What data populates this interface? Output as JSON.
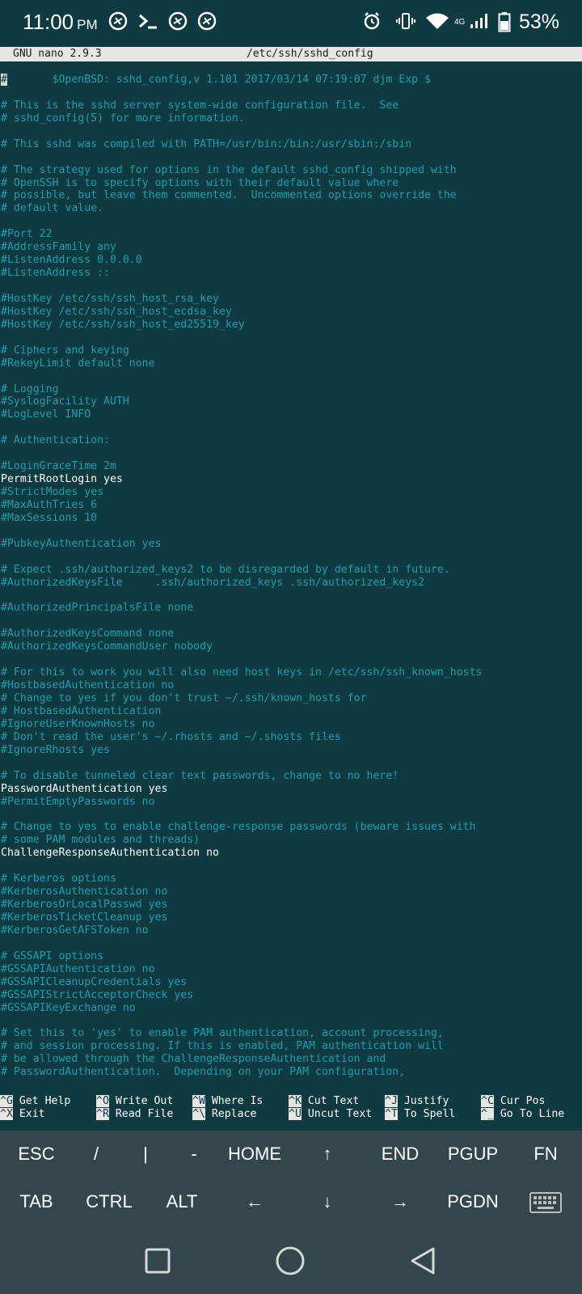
{
  "status_bar": {
    "time": "11:00",
    "ampm": "PM",
    "network": "4G",
    "battery": "53%",
    "icons": [
      "pizza-icon",
      "terminal-prompt-icon",
      "pizza-icon",
      "pizza-icon",
      "alarm-icon",
      "vibrate-icon",
      "wifi-icon",
      "signal-icon",
      "battery-icon"
    ]
  },
  "titlebar": {
    "app": "GNU nano 2.9.3",
    "file": "/etc/ssh/sshd_config"
  },
  "editor": {
    "cursor_char": "#",
    "lines": [
      {
        "text": "#\t$OpenBSD: sshd_config,v 1.101 2017/03/14 07:19:07 djm Exp $",
        "active": false
      },
      {
        "text": "",
        "active": false
      },
      {
        "text": "# This is the sshd server system-wide configuration file.  See",
        "active": false
      },
      {
        "text": "# sshd_config(5) for more information.",
        "active": false
      },
      {
        "text": "",
        "active": false
      },
      {
        "text": "# This sshd was compiled with PATH=/usr/bin:/bin:/usr/sbin:/sbin",
        "active": false
      },
      {
        "text": "",
        "active": false
      },
      {
        "text": "# The strategy used for options in the default sshd_config shipped with",
        "active": false
      },
      {
        "text": "# OpenSSH is to specify options with their default value where",
        "active": false
      },
      {
        "text": "# possible, but leave them commented.  Uncommented options override the",
        "active": false
      },
      {
        "text": "# default value.",
        "active": false
      },
      {
        "text": "",
        "active": false
      },
      {
        "text": "#Port 22",
        "active": false
      },
      {
        "text": "#AddressFamily any",
        "active": false
      },
      {
        "text": "#ListenAddress 0.0.0.0",
        "active": false
      },
      {
        "text": "#ListenAddress ::",
        "active": false
      },
      {
        "text": "",
        "active": false
      },
      {
        "text": "#HostKey /etc/ssh/ssh_host_rsa_key",
        "active": false
      },
      {
        "text": "#HostKey /etc/ssh/ssh_host_ecdsa_key",
        "active": false
      },
      {
        "text": "#HostKey /etc/ssh/ssh_host_ed25519_key",
        "active": false
      },
      {
        "text": "",
        "active": false
      },
      {
        "text": "# Ciphers and keying",
        "active": false
      },
      {
        "text": "#RekeyLimit default none",
        "active": false
      },
      {
        "text": "",
        "active": false
      },
      {
        "text": "# Logging",
        "active": false
      },
      {
        "text": "#SyslogFacility AUTH",
        "active": false
      },
      {
        "text": "#LogLevel INFO",
        "active": false
      },
      {
        "text": "",
        "active": false
      },
      {
        "text": "# Authentication:",
        "active": false
      },
      {
        "text": "",
        "active": false
      },
      {
        "text": "#LoginGraceTime 2m",
        "active": false
      },
      {
        "text": "PermitRootLogin yes",
        "active": true
      },
      {
        "text": "#StrictModes yes",
        "active": false
      },
      {
        "text": "#MaxAuthTries 6",
        "active": false
      },
      {
        "text": "#MaxSessions 10",
        "active": false
      },
      {
        "text": "",
        "active": false
      },
      {
        "text": "#PubkeyAuthentication yes",
        "active": false
      },
      {
        "text": "",
        "active": false
      },
      {
        "text": "# Expect .ssh/authorized_keys2 to be disregarded by default in future.",
        "active": false
      },
      {
        "text": "#AuthorizedKeysFile\t.ssh/authorized_keys .ssh/authorized_keys2",
        "active": false
      },
      {
        "text": "",
        "active": false
      },
      {
        "text": "#AuthorizedPrincipalsFile none",
        "active": false
      },
      {
        "text": "",
        "active": false
      },
      {
        "text": "#AuthorizedKeysCommand none",
        "active": false
      },
      {
        "text": "#AuthorizedKeysCommandUser nobody",
        "active": false
      },
      {
        "text": "",
        "active": false
      },
      {
        "text": "# For this to work you will also need host keys in /etc/ssh/ssh_known_hosts",
        "active": false
      },
      {
        "text": "#HostbasedAuthentication no",
        "active": false
      },
      {
        "text": "# Change to yes if you don't trust ~/.ssh/known_hosts for",
        "active": false
      },
      {
        "text": "# HostbasedAuthentication",
        "active": false
      },
      {
        "text": "#IgnoreUserKnownHosts no",
        "active": false
      },
      {
        "text": "# Don't read the user's ~/.rhosts and ~/.shosts files",
        "active": false
      },
      {
        "text": "#IgnoreRhosts yes",
        "active": false
      },
      {
        "text": "",
        "active": false
      },
      {
        "text": "# To disable tunneled clear text passwords, change to no here!",
        "active": false
      },
      {
        "text": "PasswordAuthentication yes",
        "active": true
      },
      {
        "text": "#PermitEmptyPasswords no",
        "active": false
      },
      {
        "text": "",
        "active": false
      },
      {
        "text": "# Change to yes to enable challenge-response passwords (beware issues with",
        "active": false
      },
      {
        "text": "# some PAM modules and threads)",
        "active": false
      },
      {
        "text": "ChallengeResponseAuthentication no",
        "active": true
      },
      {
        "text": "",
        "active": false
      },
      {
        "text": "# Kerberos options",
        "active": false
      },
      {
        "text": "#KerberosAuthentication no",
        "active": false
      },
      {
        "text": "#KerberosOrLocalPasswd yes",
        "active": false
      },
      {
        "text": "#KerberosTicketCleanup yes",
        "active": false
      },
      {
        "text": "#KerberosGetAFSToken no",
        "active": false
      },
      {
        "text": "",
        "active": false
      },
      {
        "text": "# GSSAPI options",
        "active": false
      },
      {
        "text": "#GSSAPIAuthentication no",
        "active": false
      },
      {
        "text": "#GSSAPICleanupCredentials yes",
        "active": false
      },
      {
        "text": "#GSSAPIStrictAcceptorCheck yes",
        "active": false
      },
      {
        "text": "#GSSAPIKeyExchange no",
        "active": false
      },
      {
        "text": "",
        "active": false
      },
      {
        "text": "# Set this to 'yes' to enable PAM authentication, account processing,",
        "active": false
      },
      {
        "text": "# and session processing. If this is enabled, PAM authentication will",
        "active": false
      },
      {
        "text": "# be allowed through the ChallengeResponseAuthentication and",
        "active": false
      },
      {
        "text": "# PasswordAuthentication.  Depending on your PAM configuration,",
        "active": false
      }
    ]
  },
  "shortcuts": [
    {
      "key": "^G",
      "label": "Get Help"
    },
    {
      "key": "^X",
      "label": "Exit"
    },
    {
      "key": "^O",
      "label": "Write Out"
    },
    {
      "key": "^R",
      "label": "Read File"
    },
    {
      "key": "^W",
      "label": "Where Is"
    },
    {
      "key": "^\\",
      "label": "Replace"
    },
    {
      "key": "^K",
      "label": "Cut Text"
    },
    {
      "key": "^U",
      "label": "Uncut Text"
    },
    {
      "key": "^J",
      "label": "Justify"
    },
    {
      "key": "^T",
      "label": "To Spell"
    },
    {
      "key": "^C",
      "label": "Cur Pos"
    },
    {
      "key": "^_",
      "label": "Go To Line"
    }
  ],
  "extra_keys": {
    "row1": [
      "ESC",
      "/",
      "|",
      "-",
      "HOME",
      "↑",
      "END",
      "PGUP",
      "FN"
    ],
    "row2": [
      "TAB",
      "CTRL",
      "ALT",
      "←",
      "↓",
      "→",
      "PGDN",
      "keyboard-icon"
    ]
  },
  "nav_bar": [
    "recents-square-icon",
    "home-circle-icon",
    "back-triangle-icon"
  ]
}
